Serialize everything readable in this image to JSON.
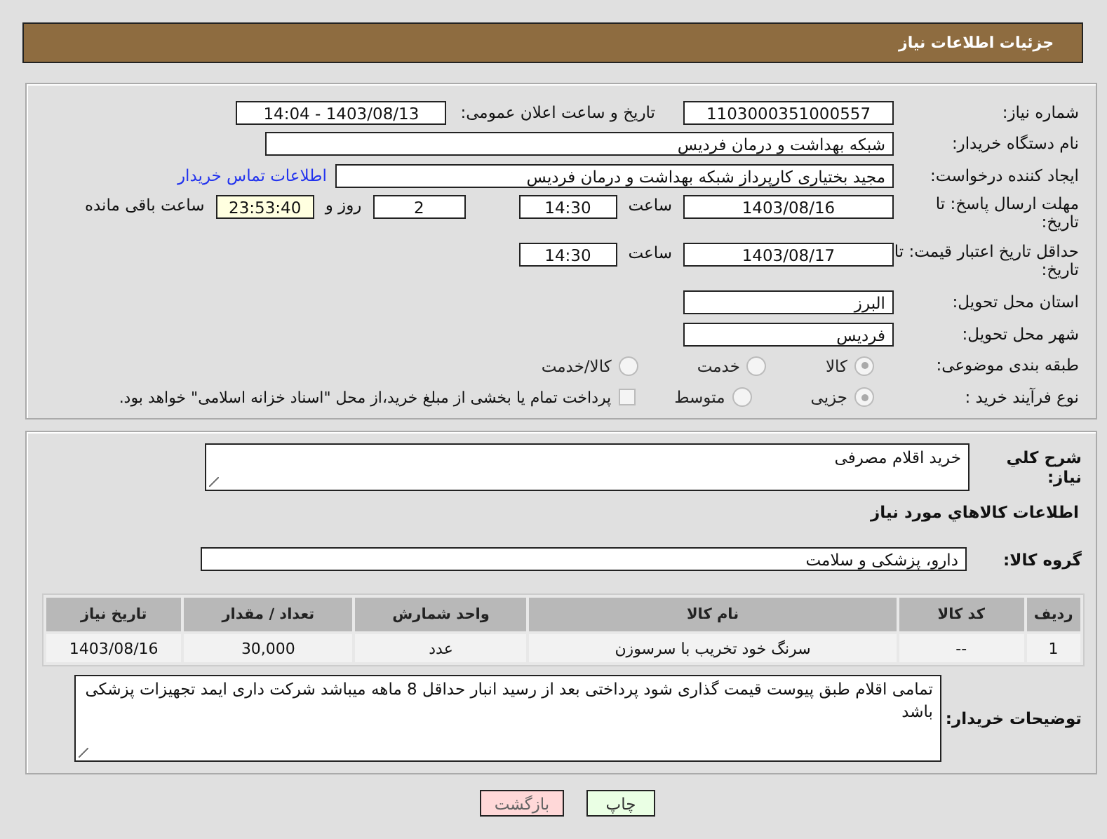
{
  "header": {
    "title": "جزئیات اطلاعات نیاز"
  },
  "details": {
    "need_number": {
      "label": "شماره نیاز:",
      "value": "1103000351000557"
    },
    "announce": {
      "label": "تاریخ و ساعت اعلان عمومی:",
      "value": "1403/08/13 - 14:04"
    },
    "buyer_org": {
      "label": "نام دستگاه خریدار:",
      "value": "شبکه بهداشت و درمان فردیس"
    },
    "creator": {
      "label": "ایجاد کننده درخواست:",
      "value": "مجید بختیاری کارپرداز شبکه بهداشت و درمان فردیس",
      "link": "اطلاعات تماس خریدار"
    },
    "reply_deadline": {
      "label": "مهلت ارسال پاسخ: تا تاریخ:",
      "date": "1403/08/16",
      "time_label": "ساعت",
      "time": "14:30",
      "days": "2",
      "days_label": "روز و",
      "remaining": "23:53:40",
      "remaining_label": "ساعت باقی مانده"
    },
    "price_validity": {
      "label": "حداقل تاریخ اعتبار قیمت: تا تاریخ:",
      "date": "1403/08/17",
      "time_label": "ساعت",
      "time": "14:30"
    },
    "province": {
      "label": "استان محل تحویل:",
      "value": "البرز"
    },
    "city": {
      "label": "شهر محل تحویل:",
      "value": "فردیس"
    },
    "category": {
      "label": "طبقه بندی موضوعی:",
      "options": [
        {
          "label": "کالا",
          "selected": true
        },
        {
          "label": "خدمت",
          "selected": false
        },
        {
          "label": "کالا/خدمت",
          "selected": false
        }
      ]
    },
    "process": {
      "label": "نوع فرآیند خرید :",
      "options": [
        {
          "label": "جزیی",
          "selected": true
        },
        {
          "label": "متوسط",
          "selected": false
        }
      ],
      "treasury": {
        "label": "پرداخت تمام یا بخشی از مبلغ خرید،از محل \"اسناد خزانه اسلامی\" خواهد بود.",
        "checked": false
      }
    }
  },
  "goods": {
    "description": {
      "label": "شرح کلي نياز:",
      "value": "خرید اقلام مصرفی"
    },
    "section_title": "اطلاعات کالاهاي مورد نياز",
    "group": {
      "label": "گروه کالا:",
      "value": "دارو، پزشکی و سلامت"
    },
    "table": {
      "columns": [
        "ردیف",
        "کد کالا",
        "نام کالا",
        "واحد شمارش",
        "تعداد / مقدار",
        "تاریخ نیاز"
      ],
      "rows": [
        [
          "1",
          "--",
          "سرنگ خود تخریب با سرسوزن",
          "عدد",
          "30,000",
          "1403/08/16"
        ]
      ]
    },
    "buyer_notes": {
      "label": "توضیحات خریدار:",
      "value": "تمامی اقلام طبق پیوست قیمت گذاری شود پرداختی بعد از رسید انبار حداقل 8 ماهه میباشد شرکت داری ایمد تجهیزات پزشکی باشد"
    }
  },
  "buttons": [
    {
      "kind": "print",
      "label": "چاپ"
    },
    {
      "kind": "back",
      "label": "بازگشت"
    }
  ]
}
